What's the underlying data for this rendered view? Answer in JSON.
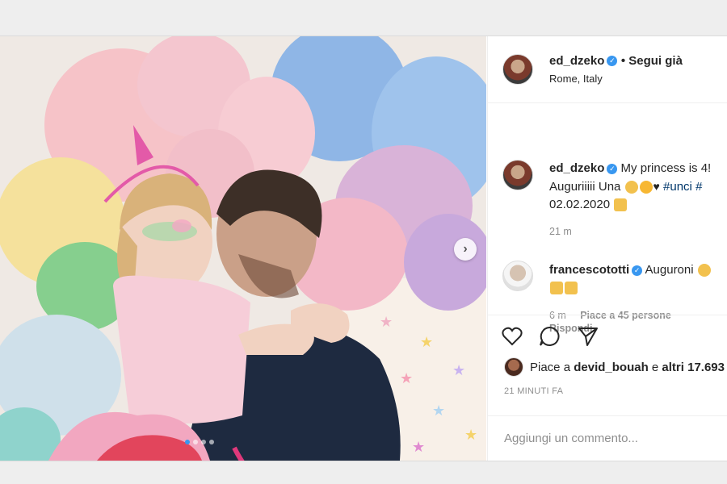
{
  "post": {
    "author": "ed_dzeko",
    "follow_status": "Segui già",
    "location": "Rome, Italy",
    "caption_start": "My princess is 4!",
    "caption_line2": "Auguriiiii Una",
    "caption_tag": "#unci",
    "caption_tag_more": "#",
    "caption_date": "02.02.2020",
    "caption_time": "21 m",
    "caption_emojis": [
      "party-popper",
      "heart-eyes",
      "black-heart",
      "party-popper"
    ]
  },
  "comments": [
    {
      "author": "francescototti",
      "text": "Auguroni",
      "emojis": [
        "clapping-hands",
        "party-popper",
        "party-popper"
      ],
      "time": "6 m",
      "likes_label": "Piace a 45 persone",
      "reply_label": "Rispondi"
    }
  ],
  "actions": {
    "like_icon": "heart-outline-icon",
    "comment_icon": "speech-bubble-icon",
    "share_icon": "paper-plane-icon"
  },
  "likes": {
    "prefix": "Piace a",
    "user": "devid_bouah",
    "connector": "e",
    "others": "altri 17.693"
  },
  "posted_ago": "21 MINUTI FA",
  "comment_input": {
    "placeholder": "Aggiungi un commento..."
  },
  "carousel": {
    "slides": 4,
    "active": 1
  },
  "colors": {
    "link": "#00376b",
    "verified": "#3897f0",
    "muted": "#8e8e8e",
    "text": "#262626"
  }
}
